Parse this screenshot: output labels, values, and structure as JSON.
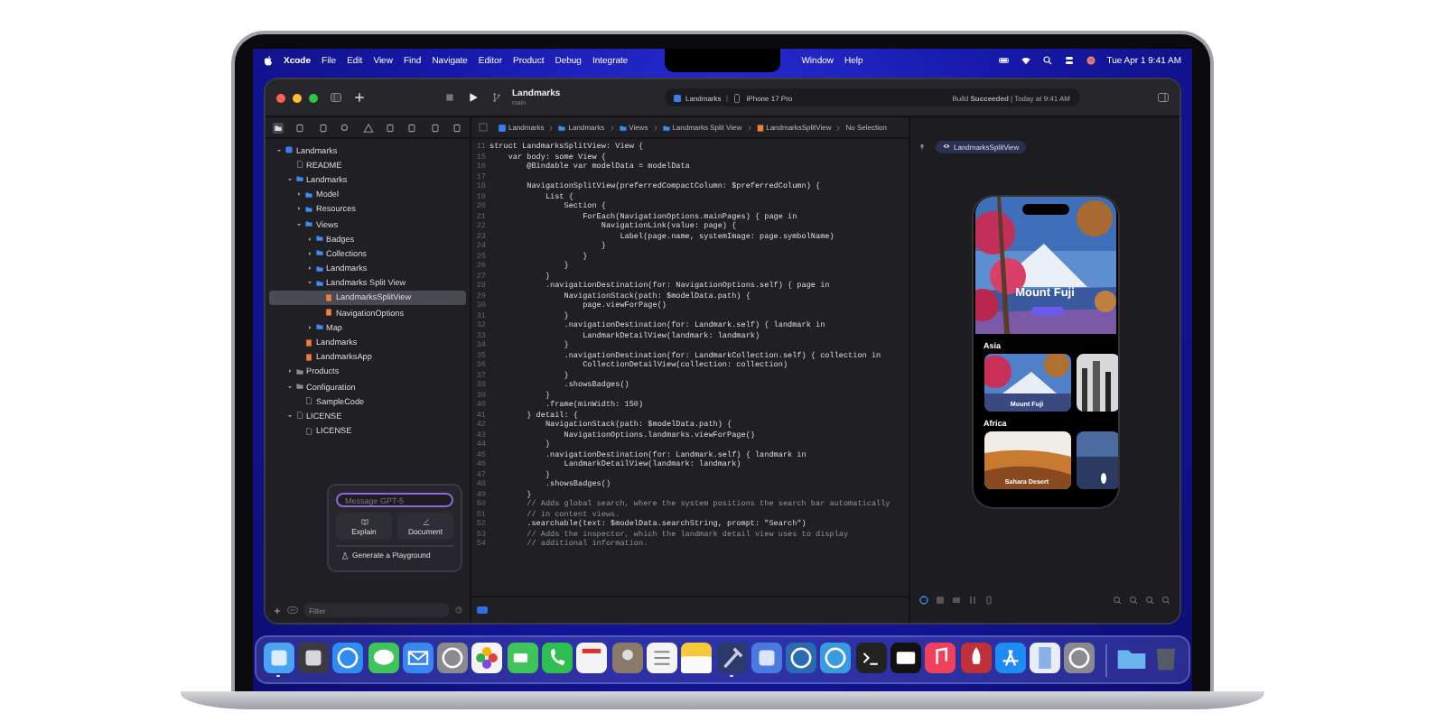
{
  "menu_bar": {
    "app": "Xcode",
    "menus": [
      "File",
      "Edit",
      "View",
      "Find",
      "Navigate",
      "Editor",
      "Product",
      "Debug",
      "Integrate"
    ],
    "menus_right": [
      "Window",
      "Help"
    ],
    "clock": "Tue Apr 1  9:41 AM"
  },
  "toolbar": {
    "project": "Landmarks",
    "branch": "main",
    "scheme": "Landmarks",
    "device": "iPhone 17 Pro",
    "status": "Build **Succeeded** | Today at 9:41 AM"
  },
  "navigator": {
    "tree": [
      {
        "name": "Landmarks",
        "kind": "project",
        "expanded": true,
        "selected": false,
        "children": [
          {
            "name": "README",
            "kind": "doc",
            "selected": false
          },
          {
            "name": "Landmarks",
            "kind": "folder",
            "expanded": true,
            "selected": false,
            "children": [
              {
                "name": "Model",
                "kind": "folder",
                "expanded": false,
                "selected": false
              },
              {
                "name": "Resources",
                "kind": "folder",
                "expanded": false,
                "selected": false
              },
              {
                "name": "Views",
                "kind": "folder",
                "expanded": true,
                "selected": false,
                "children": [
                  {
                    "name": "Badges",
                    "kind": "folder",
                    "expanded": false,
                    "selected": false
                  },
                  {
                    "name": "Collections",
                    "kind": "folder",
                    "expanded": false,
                    "selected": false
                  },
                  {
                    "name": "Landmarks",
                    "kind": "folder",
                    "expanded": false,
                    "selected": false
                  },
                  {
                    "name": "Landmarks Split View",
                    "kind": "folder",
                    "expanded": true,
                    "selected": false,
                    "children": [
                      {
                        "name": "LandmarksSplitView",
                        "kind": "swift",
                        "selected": true
                      },
                      {
                        "name": "NavigationOptions",
                        "kind": "swift",
                        "selected": false
                      }
                    ]
                  },
                  {
                    "name": "Map",
                    "kind": "folder",
                    "expanded": false,
                    "selected": false
                  }
                ]
              },
              {
                "name": "Landmarks",
                "kind": "swift",
                "selected": false
              },
              {
                "name": "LandmarksApp",
                "kind": "swift",
                "selected": false
              }
            ]
          },
          {
            "name": "Products",
            "kind": "group",
            "expanded": false,
            "selected": false
          },
          {
            "name": "Configuration",
            "kind": "group",
            "expanded": true,
            "selected": false,
            "children": [
              {
                "name": "SampleCode",
                "kind": "doc",
                "selected": false
              }
            ]
          },
          {
            "name": "LICENSE",
            "kind": "doc",
            "expanded": true,
            "selected": false,
            "children": [
              {
                "name": "LICENSE",
                "kind": "doc",
                "selected": false
              }
            ]
          }
        ]
      }
    ],
    "assistant": {
      "placeholder": "Message GPT-5",
      "actions": [
        "Explain",
        "Document"
      ],
      "generate": "Generate a Playground"
    },
    "filter": {
      "placeholder": "Filter"
    }
  },
  "editor": {
    "breadcrumbs": [
      {
        "label": "Landmarks",
        "kind": "project"
      },
      {
        "label": "Landmarks",
        "kind": "folder"
      },
      {
        "label": "Views",
        "kind": "folder"
      },
      {
        "label": "Landmarks Split View",
        "kind": "folder"
      },
      {
        "label": "LandmarksSplitView",
        "kind": "swift"
      },
      {
        "label": "No Selection",
        "kind": "none"
      }
    ],
    "lines": [
      {
        "n": "11",
        "text": "struct LandmarksSplitView: View {",
        "kind": "code"
      },
      {
        "n": "15",
        "text": "    var body: some View {",
        "kind": "code"
      },
      {
        "n": "16",
        "text": "        @Bindable var modelData = modelData",
        "kind": "code"
      },
      {
        "n": "17"
      },
      {
        "n": "18",
        "text": "        NavigationSplitView(preferredCompactColumn: $preferredColumn) {",
        "kind": "code"
      },
      {
        "n": "19",
        "text": "            List {",
        "kind": "code"
      },
      {
        "n": "20",
        "text": "                Section {",
        "kind": "code"
      },
      {
        "n": "21",
        "text": "                    ForEach(NavigationOptions.mainPages) { page in",
        "kind": "code"
      },
      {
        "n": "22",
        "text": "                        NavigationLink(value: page) {",
        "kind": "code"
      },
      {
        "n": "23",
        "text": "                            Label(page.name, systemImage: page.symbolName)",
        "kind": "code"
      },
      {
        "n": "24",
        "text": "                        }",
        "kind": "code"
      },
      {
        "n": "25",
        "text": "                    }",
        "kind": "code"
      },
      {
        "n": "26",
        "text": "                }",
        "kind": "code"
      },
      {
        "n": "27",
        "text": "            }",
        "kind": "code"
      },
      {
        "n": "28",
        "text": "            .navigationDestination(for: NavigationOptions.self) { page in",
        "kind": "code"
      },
      {
        "n": "29",
        "text": "                NavigationStack(path: $modelData.path) {",
        "kind": "code"
      },
      {
        "n": "30",
        "text": "                    page.viewForPage()",
        "kind": "code"
      },
      {
        "n": "31",
        "text": "                }",
        "kind": "code"
      },
      {
        "n": "32",
        "text": "                .navigationDestination(for: Landmark.self) { landmark in",
        "kind": "code"
      },
      {
        "n": "33",
        "text": "                    LandmarkDetailView(landmark: landmark)",
        "kind": "code"
      },
      {
        "n": "34",
        "text": "                }",
        "kind": "code"
      },
      {
        "n": "35",
        "text": "                .navigationDestination(for: LandmarkCollection.self) { collection in",
        "kind": "code"
      },
      {
        "n": "36",
        "text": "                    CollectionDetailView(collection: collection)",
        "kind": "code"
      },
      {
        "n": "37",
        "text": "                }",
        "kind": "code"
      },
      {
        "n": "38",
        "text": "                .showsBadges()",
        "kind": "code"
      },
      {
        "n": "39",
        "text": "            }",
        "kind": "code"
      },
      {
        "n": "40",
        "text": "            .frame(minWidth: 150)",
        "kind": "code"
      },
      {
        "n": "41",
        "text": "        } detail: {",
        "kind": "code"
      },
      {
        "n": "42",
        "text": "            NavigationStack(path: $modelData.path) {",
        "kind": "code"
      },
      {
        "n": "43",
        "text": "                NavigationOptions.landmarks.viewForPage()",
        "kind": "code"
      },
      {
        "n": "44",
        "text": "            }",
        "kind": "code"
      },
      {
        "n": "45",
        "text": "            .navigationDestination(for: Landmark.self) { landmark in",
        "kind": "code"
      },
      {
        "n": "46",
        "text": "                LandmarkDetailView(landmark: landmark)",
        "kind": "code"
      },
      {
        "n": "47",
        "text": "            }",
        "kind": "code"
      },
      {
        "n": "48",
        "text": "            .showsBadges()",
        "kind": "code"
      },
      {
        "n": "49",
        "text": "        }",
        "kind": "code"
      },
      {
        "n": "50",
        "text": "        // Adds global search, where the system positions the search bar automatically",
        "kind": "comment"
      },
      {
        "n": "51",
        "text": "        // in content views.",
        "kind": "comment"
      },
      {
        "n": "52",
        "text": "        .searchable(text: $modelData.searchString, prompt: \"Search\")",
        "kind": "code"
      },
      {
        "n": "53",
        "text": "        // Adds the inspector, which the landmark detail view uses to display",
        "kind": "comment"
      },
      {
        "n": "54",
        "text": "        // additional information.",
        "kind": "comment"
      }
    ]
  },
  "preview": {
    "title": "LandmarksSplitView",
    "hero_title": "Mount Fuji",
    "sections": [
      {
        "title": "Asia",
        "cards": [
          {
            "label": "Mount Fuji",
            "kind": "blossom"
          },
          {
            "kind": "forest"
          }
        ]
      },
      {
        "title": "Africa",
        "cards": [
          {
            "label": "Sahara Desert",
            "kind": "desert"
          },
          {
            "kind": "sea"
          }
        ]
      }
    ]
  },
  "dock": {
    "apps": [
      {
        "running": true
      },
      {
        "running": false
      },
      {
        "running": false
      },
      {
        "running": false
      },
      {
        "running": false
      },
      {
        "running": false
      },
      {
        "running": false
      },
      {
        "running": false
      },
      {
        "running": false
      },
      {
        "running": false
      },
      {
        "running": false
      },
      {
        "running": false
      },
      {
        "running": false
      },
      {
        "running": true
      },
      {
        "running": false
      },
      {
        "running": false
      },
      {
        "running": false
      },
      {
        "running": false
      },
      {
        "running": false
      },
      {
        "running": false
      },
      {
        "running": false
      },
      {
        "running": false
      },
      {
        "running": false
      },
      {
        "running": false
      }
    ]
  }
}
